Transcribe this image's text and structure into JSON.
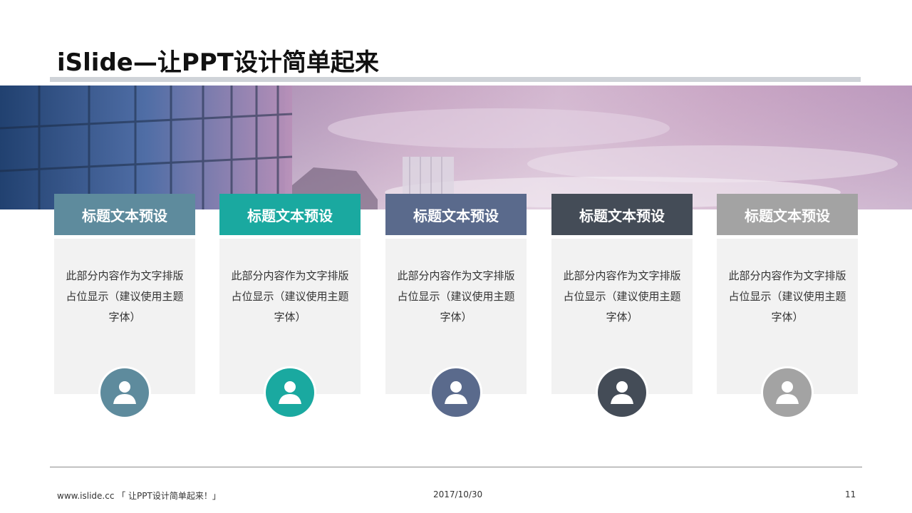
{
  "slide": {
    "title": "iSlide—让PPT设计简单起来"
  },
  "cards": [
    {
      "heading": "标题文本预设",
      "body": "此部分内容作为文字排版占位显示（建议使用主题字体）",
      "color": "#5e8b9d"
    },
    {
      "heading": "标题文本预设",
      "body": "此部分内容作为文字排版占位显示（建议使用主题字体）",
      "color": "#1aa9a0"
    },
    {
      "heading": "标题文本预设",
      "body": "此部分内容作为文字排版占位显示（建议使用主题字体）",
      "color": "#5a6a8c"
    },
    {
      "heading": "标题文本预设",
      "body": "此部分内容作为文字排版占位显示（建议使用主题字体）",
      "color": "#444c57"
    },
    {
      "heading": "标题文本预设",
      "body": "此部分内容作为文字排版占位显示（建议使用主题字体）",
      "color": "#a3a3a3"
    }
  ],
  "card_icon": "user-avatar-icon",
  "footer": {
    "left": "www.islide.cc 「 让PPT设计简单起来！」",
    "date": "2017/10/30",
    "page_number": "11"
  }
}
